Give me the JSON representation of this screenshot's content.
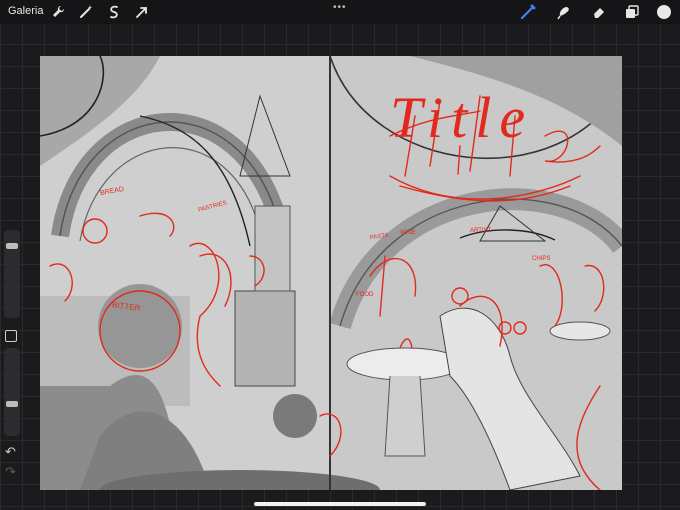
{
  "app": {
    "gallery_label": "Galeria",
    "accent_color": "#3b82f6",
    "sketch_red": "#e12a1c"
  },
  "toolbar": {
    "left_tools": [
      "wrench-icon",
      "magic-wand-icon",
      "selection-icon",
      "transform-arrow-icon"
    ],
    "right_tools": [
      "brush-icon",
      "smudge-icon",
      "eraser-icon",
      "layers-icon",
      "color-swatch"
    ],
    "menu_glyph": "•••",
    "active_tool": "brush-icon",
    "color": "#e6e6e6"
  },
  "canvas": {
    "sketch_title": "Title",
    "sign_labels": [
      "BITTER",
      "BREAD",
      "PASTRIES",
      "PASTA",
      "WINE",
      "CHIPS",
      "FOOD",
      "ARTIST"
    ]
  },
  "sidebar": {
    "brush_size_percent": 85,
    "opacity_percent": 35,
    "undo_glyph": "↶",
    "redo_glyph": "↷"
  }
}
